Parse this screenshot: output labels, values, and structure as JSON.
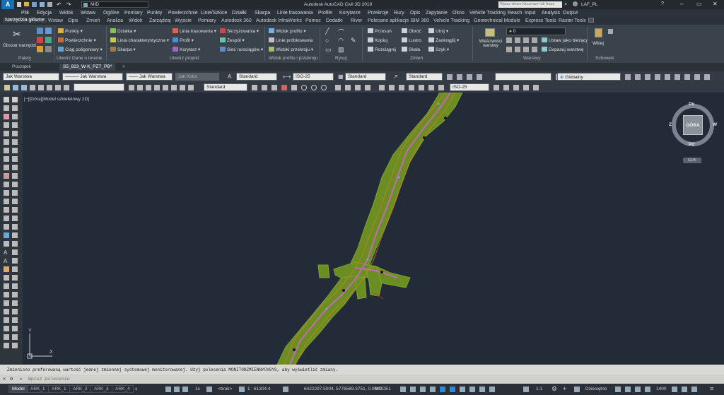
{
  "titlebar": {
    "app_title": "Autodesk AutoCAD Civil 3D 2018",
    "workspace": "MID",
    "search_placeholder": "Wpisz słowo kluczowe lub frazę",
    "user": "LAF_PL"
  },
  "menubar": {
    "items": [
      "Plik",
      "Edycja",
      "Widok",
      "Wstaw",
      "Ogólne",
      "Pomiary",
      "Punkty",
      "Powierzchnie",
      "Linie/Szkice",
      "Działki",
      "Skarpa",
      "Linie trasowania",
      "Profile",
      "Korytarze",
      "Przekroje",
      "Rury",
      "Opis",
      "Zapytanie",
      "Okno",
      "Vehicle Tracking",
      "Reach",
      "Input",
      "Analysis",
      "Output"
    ]
  },
  "ribbon_tabs": {
    "items": [
      "Narzędzia główne",
      "Wstaw",
      "Opis",
      "Zmień",
      "Analiza",
      "Widok",
      "Zarządzaj",
      "Wyjście",
      "Pomiary",
      "Autodesk 360",
      "Autodesk InfraWorks",
      "Pomoc",
      "Dodatki",
      "River",
      "Polecane aplikacje",
      "BIM 360",
      "Vehicle Tracking",
      "Geotechnical Module",
      "Express Tools",
      "Raster Tools"
    ]
  },
  "ribbon": {
    "workspace_btn": "Obszar narzędzi",
    "palettes": "Palety",
    "col1": [
      "Punkty",
      "Powierzchnie",
      "Ciąg poligonowy"
    ],
    "col2": [
      "Działka",
      "Linia charakterystyczna",
      "Skarpa"
    ],
    "col3": [
      "Linia trasowania",
      "Profil",
      "Korytarz"
    ],
    "col4": [
      "Skrzyżowania",
      "Zespół",
      "Sieć rurociągów"
    ],
    "col5": [
      "Widok profilu",
      "Linie próbkowania",
      "Widoki przekroju"
    ],
    "col6": [
      "Przesuń",
      "Kopiuj",
      "Rozciągnij"
    ],
    "col7": [
      "Obróć",
      "Lustro",
      "Skala"
    ],
    "col8": [
      "Utnij",
      "Zaokrąglij",
      "Szyk"
    ],
    "layer_props": "Właściwości warstwy",
    "layer_combo": "0",
    "layer_actions": [
      "Ustaw jako bieżący",
      "Dopasuj warstwę"
    ],
    "paste": "Wklej",
    "groups": [
      "Palety",
      "Utwórz Dane o terenie",
      "Utwórz projekt",
      "Widok profilu i przekroju",
      "Rysuj",
      "Zmień",
      "Warstwy",
      "Schowek"
    ]
  },
  "filetabs": {
    "start": "Początek",
    "active": "S5_823_W-K_PZT_PB*",
    "add": "+"
  },
  "toolbar1": {
    "combos": [
      "Jak Warstwa",
      "Jak Warstwa",
      "Jak Warstwa",
      "Jak Kolor",
      "Standard",
      "ISO-25",
      "Standard",
      "Standard",
      "Globalny"
    ]
  },
  "toolbar2": {
    "combos": [
      "Standard",
      "ISO-25",
      "Standard"
    ]
  },
  "viewport": {
    "label": "[−][Góra][Model szkieletowy 2D]",
    "viewcube": {
      "top": "Góra",
      "n": "Pn",
      "s": "Pd",
      "w": "Z",
      "e": "W",
      "wcs": "GUK"
    },
    "ucs_x": "X",
    "ucs_y": "Y"
  },
  "command": {
    "history": "Zmieniono preferowaną wartość jednej zmiennej systemowej monitorowanej. Użyj polecenia MONITORZMIENNYCHSYS, aby wyświetlić zmiany.",
    "placeholder": "Wpisz polecenie"
  },
  "statusbar": {
    "tabs": [
      "Model",
      "ARK_1",
      "ARK_1",
      "ARK_2",
      "ARK_3",
      "ARK_4"
    ],
    "brak": "<brak>",
    "scale": "1 : 61304.4",
    "coords": "6422297.5004, 5776569.3751, 0.0000",
    "mode": "MODEL",
    "anno_scale": "1:1",
    "units": "Dziesiętne",
    "zoom": "1400"
  },
  "colors": {
    "canvas_bg": "#232b38",
    "road_green": "#6b8e23",
    "road_magenta": "#c46ab4",
    "road_orange": "#d07a2a",
    "accent_blue": "#2e86de"
  }
}
